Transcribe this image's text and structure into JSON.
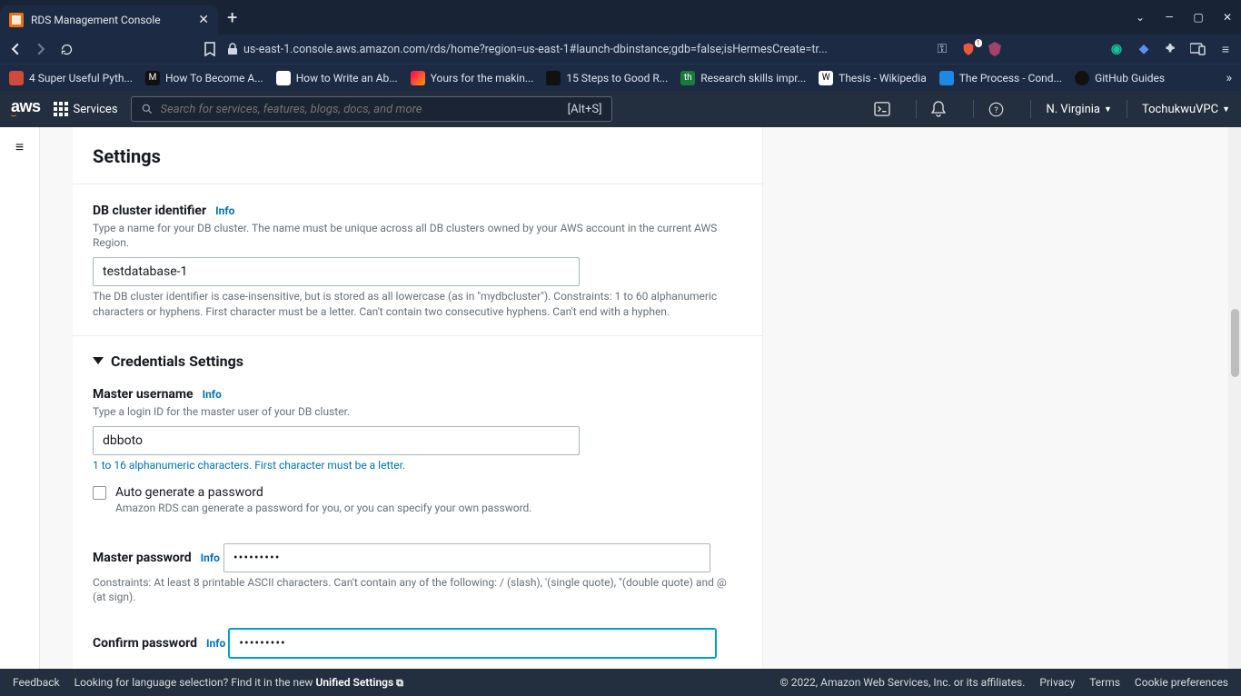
{
  "browser": {
    "tab_title": "RDS Management Console",
    "url": "us-east-1.console.aws.amazon.com/rds/home?region=us-east-1#launch-dbinstance;gdb=false;isHermesCreate=tr...",
    "bookmarks": [
      {
        "label": "4 Super Useful Pyth..."
      },
      {
        "label": "How To Become A..."
      },
      {
        "label": "How to Write an Ab..."
      },
      {
        "label": "Yours for the makin..."
      },
      {
        "label": "15 Steps to Good R..."
      },
      {
        "label": "Research skills impr..."
      },
      {
        "label": "Thesis - Wikipedia"
      },
      {
        "label": "The Process - Cond..."
      },
      {
        "label": "GitHub Guides"
      }
    ]
  },
  "aws": {
    "services_label": "Services",
    "search_placeholder": "Search for services, features, blogs, docs, and more",
    "search_hotkey": "[Alt+S]",
    "region": "N. Virginia",
    "account": "TochukwuVPC"
  },
  "form": {
    "settings_heading": "Settings",
    "cluster_id": {
      "label": "DB cluster identifier",
      "info": "Info",
      "help": "Type a name for your DB cluster. The name must be unique across all DB clusters owned by your AWS account in the current AWS Region.",
      "value": "testdatabase-1",
      "constraints": "The DB cluster identifier is case-insensitive, but is stored as all lowercase (as in \"mydbcluster\"). Constraints: 1 to 60 alphanumeric characters or hyphens. First character must be a letter. Can't contain two consecutive hyphens. Can't end with a hyphen."
    },
    "cred_heading": "Credentials Settings",
    "master_user": {
      "label": "Master username",
      "info": "Info",
      "help": "Type a login ID for the master user of your DB cluster.",
      "value": "dbboto",
      "constraints": "1 to 16 alphanumeric characters. First character must be a letter."
    },
    "auto_gen": {
      "label": "Auto generate a password",
      "help": "Amazon RDS can generate a password for you, or you can specify your own password."
    },
    "master_pwd": {
      "label": "Master password",
      "info": "Info",
      "value": "•••••••••",
      "constraints": "Constraints: At least 8 printable ASCII characters. Can't contain any of the following: / (slash), '(single quote), \"(double quote) and @ (at sign)."
    },
    "confirm_pwd": {
      "label": "Confirm password",
      "info": "Info",
      "value": "•••••••••"
    }
  },
  "footer": {
    "feedback": "Feedback",
    "lang_prompt": "Looking for language selection? Find it in the new",
    "unified": "Unified Settings",
    "copyright": "© 2022, Amazon Web Services, Inc. or its affiliates.",
    "privacy": "Privacy",
    "terms": "Terms",
    "cookies": "Cookie preferences"
  }
}
